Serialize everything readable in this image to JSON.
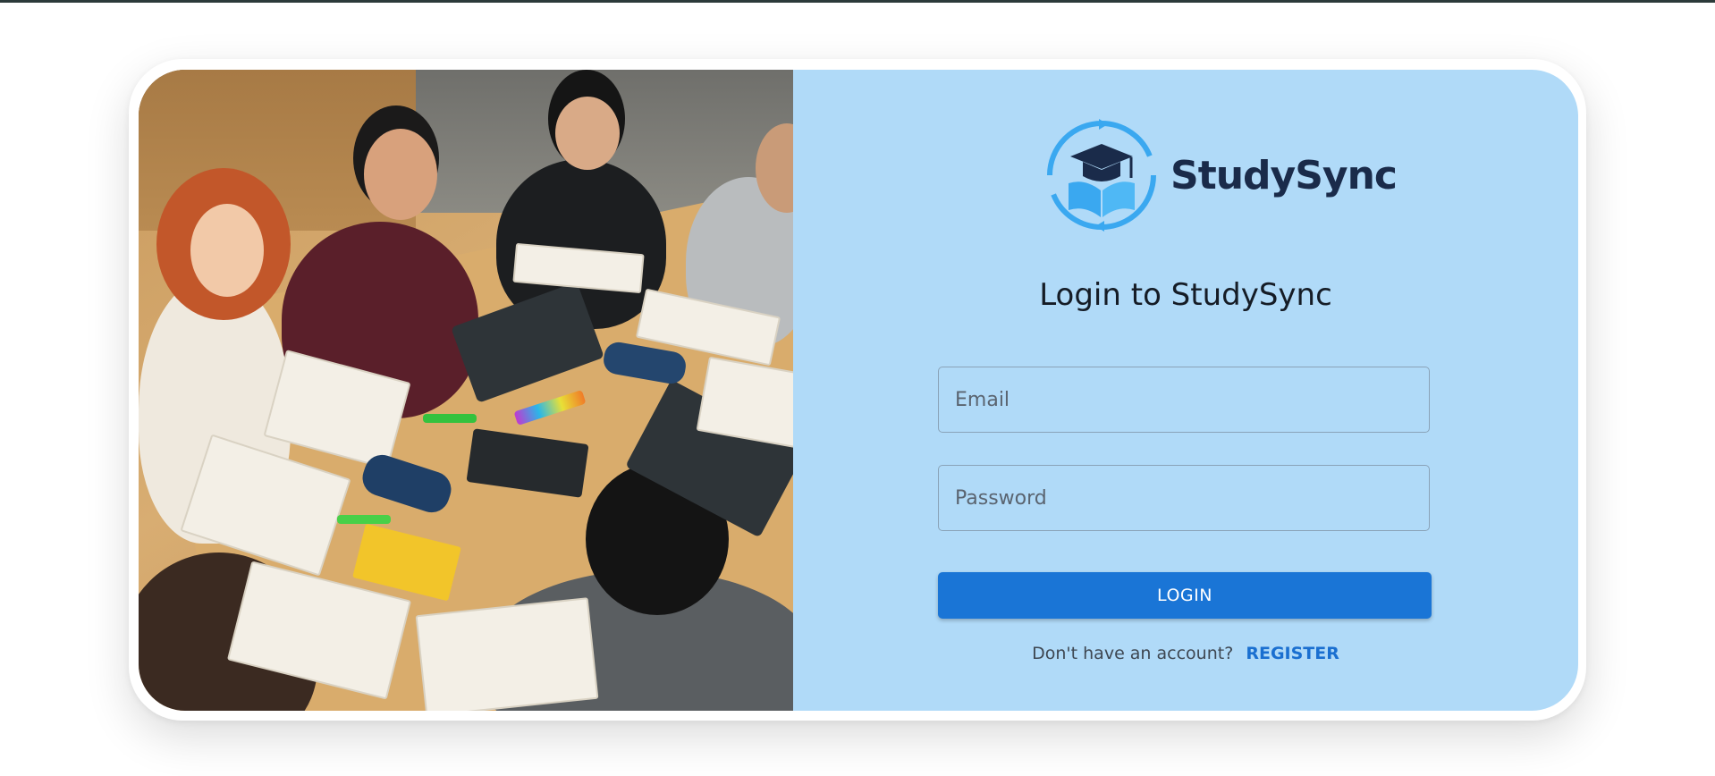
{
  "brand": {
    "name": "StudySync",
    "logo_icon": "graduation-cap-book-sync-icon",
    "colors": {
      "accent": "#1a75d6",
      "logo_light": "#3aa8f0",
      "logo_dark": "#1a2b4a",
      "panel_bg": "#b0daf8"
    }
  },
  "login": {
    "heading": "Login to StudySync",
    "email_placeholder": "Email",
    "password_placeholder": "Password",
    "submit_label": "LOGIN",
    "register_prompt": "Don't have an account?",
    "register_label": "REGISTER"
  }
}
